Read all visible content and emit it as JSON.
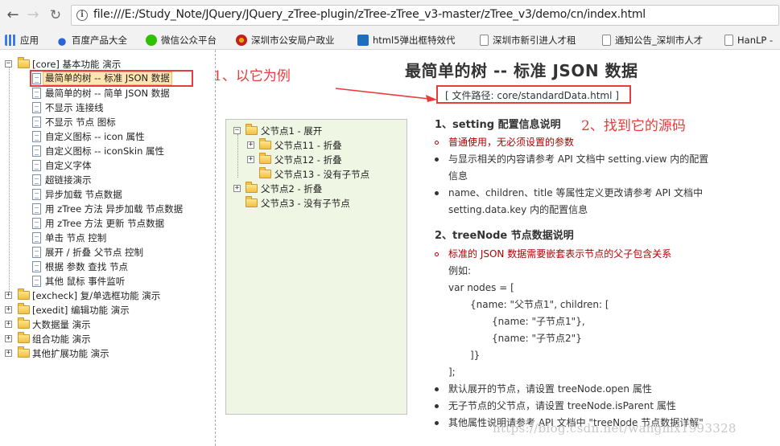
{
  "browser": {
    "url": "file:///E:/Study_Note/JQuery/JQuery_zTree-plugin/zTree-zTree_v3-master/zTree_v3/demo/cn/index.html",
    "bookmarks": [
      {
        "label": "应用",
        "icon": "apps-grid-icon"
      },
      {
        "label": "百度产品大全",
        "icon": "baidu-paw-icon"
      },
      {
        "label": "微信公众平台",
        "icon": "wechat-icon"
      },
      {
        "label": "深圳市公安局户政业",
        "icon": "police-badge-icon"
      },
      {
        "label": "html5弹出框特效代",
        "icon": "h5-icon"
      },
      {
        "label": "深圳市新引进人才租",
        "icon": "document-icon"
      },
      {
        "label": "通知公告_深圳市人才",
        "icon": "document-icon"
      },
      {
        "label": "HanLP -",
        "icon": "document-icon"
      }
    ]
  },
  "left_tree": {
    "root": "[core] 基本功能 演示",
    "core_items": [
      "最简单的树 -- 标准 JSON 数据",
      "最简单的树 -- 简单 JSON 数据",
      "不显示 连接线",
      "不显示 节点 图标",
      "自定义图标 -- icon 属性",
      "自定义图标 -- iconSkin 属性",
      "自定义字体",
      "超链接演示",
      "异步加载 节点数据",
      "用 zTree 方法 异步加载 节点数据",
      "用 zTree 方法 更新 节点数据",
      "单击 节点 控制",
      "展开 / 折叠 父节点 控制",
      "根据 参数 查找 节点",
      "其他 鼠标 事件监听"
    ],
    "other_groups": [
      "[excheck] 复/单选框功能 演示",
      "[exedit] 编辑功能 演示",
      "大数据量 演示",
      "组合功能 演示",
      "其他扩展功能 演示"
    ]
  },
  "main": {
    "title": "最简单的树 -- 标准 JSON 数据",
    "file_path": "[ 文件路径: core/standardData.html ]",
    "demo_tree": {
      "parent1": "父节点1 - 展开",
      "child11": "父节点11 - 折叠",
      "child12": "父节点12 - 折叠",
      "child13": "父节点13 - 没有子节点",
      "parent2": "父节点2 - 折叠",
      "parent3": "父节点3 - 没有子节点"
    },
    "section1": {
      "title": "1、setting 配置信息说明",
      "b1": "普通使用，无必须设置的参数",
      "b2a": "与显示相关的内容请参考 API 文档中 setting.view 内的配置",
      "b2b": "信息",
      "b3a": "name、children、title 等属性定义更改请参考 API 文档中",
      "b3b": "setting.data.key 内的配置信息"
    },
    "section2": {
      "title": "2、treeNode 节点数据说明",
      "b1": "标准的 JSON 数据需要嵌套表示节点的父子包含关系",
      "example": "例如:",
      "code": [
        "var nodes = [",
        "{name: \"父节点1\", children: [",
        "{name: \"子节点1\"},",
        "{name: \"子节点2\"}",
        "]}",
        "];"
      ],
      "b2": "默认展开的节点，请设置 treeNode.open 属性",
      "b3": "无子节点的父节点，请设置 treeNode.isParent 属性",
      "b4": "其他属性说明请参考 API 文档中 \"treeNode 节点数据详解\""
    }
  },
  "annotations": {
    "note1": "1、以它为例",
    "note2": "2、找到它的源码"
  },
  "watermark": "https://blog.csdn.net/wangmx1993328"
}
